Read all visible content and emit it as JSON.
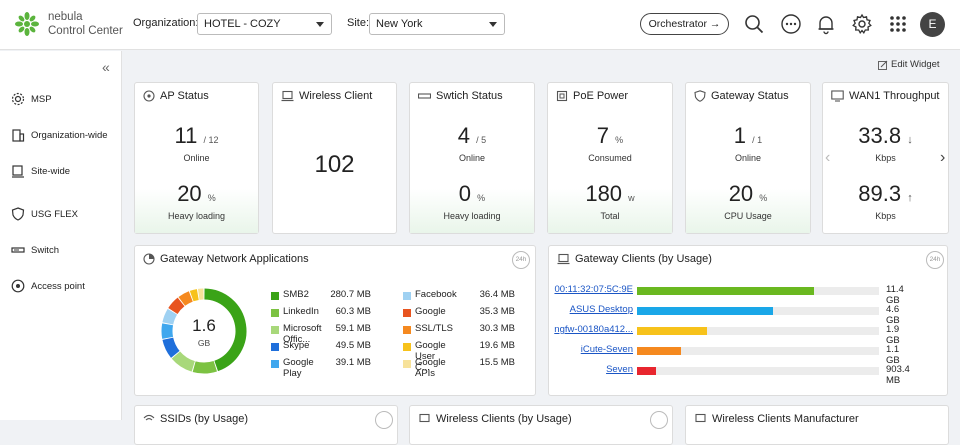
{
  "app": {
    "brand_line1": "nebula",
    "brand_line2": "Control Center"
  },
  "header": {
    "org_label": "Organization:",
    "org_value": "HOTEL - COZY",
    "site_label": "Site:",
    "site_value": "New York",
    "orchestrator_label": "Orchestrator →",
    "avatar_letter": "E",
    "icons": [
      "search-icon",
      "more-icon",
      "bell-icon",
      "gear-icon",
      "apps-grid-icon"
    ]
  },
  "sidebar": {
    "collapse": "«",
    "items": [
      {
        "label": "MSP",
        "icon": "msp-icon"
      },
      {
        "label": "Organization-wide",
        "icon": "building-icon"
      },
      {
        "label": "Site-wide",
        "icon": "site-icon"
      },
      {
        "label": "USG FLEX",
        "icon": "shield-icon"
      },
      {
        "label": "Switch",
        "icon": "switch-icon"
      },
      {
        "label": "Access point",
        "icon": "access-point-icon"
      }
    ]
  },
  "edit_widget": "Edit Widget",
  "cards": {
    "ap": {
      "title": "AP Status",
      "top_value": "11",
      "top_unit": "/ 12",
      "top_label": "Online",
      "bottom_value": "20",
      "bottom_unit": "%",
      "bottom_label": "Heavy loading"
    },
    "wireless": {
      "title": "Wireless Client",
      "value": "102"
    },
    "switch": {
      "title": "Swtich Status",
      "top_value": "4",
      "top_unit": "/ 5",
      "top_label": "Online",
      "bottom_value": "0",
      "bottom_unit": "%",
      "bottom_label": "Heavy loading"
    },
    "poe": {
      "title": "PoE Power",
      "top_value": "7",
      "top_unit": "%",
      "top_label": "Consumed",
      "bottom_value": "180",
      "bottom_unit": "w",
      "bottom_label": "Total"
    },
    "gateway": {
      "title": "Gateway Status",
      "top_value": "1",
      "top_unit": "/ 1",
      "top_label": "Online",
      "bottom_value": "20",
      "bottom_unit": "%",
      "bottom_label": "CPU Usage"
    },
    "wan": {
      "title": "WAN1 Throughput",
      "top_value": "33.8",
      "top_arrow": "↓",
      "top_label": "Kbps",
      "bottom_value": "89.3",
      "bottom_arrow": "↑",
      "bottom_label": "Kbps",
      "prev": "‹",
      "next": "›"
    }
  },
  "apps": {
    "title": "Gateway Network Applications",
    "badge": "24h",
    "total_value": "1.6",
    "total_unit": "GB",
    "left": [
      {
        "name": "SMB2",
        "value": "280.7 MB",
        "color": "#3aa317"
      },
      {
        "name": "LinkedIn",
        "value": "60.3 MB",
        "color": "#7cc242"
      },
      {
        "name": "Microsoft Offic...",
        "value": "59.1 MB",
        "color": "#a8d87a"
      },
      {
        "name": "Skype",
        "value": "49.5 MB",
        "color": "#1f6fdb"
      },
      {
        "name": "Google Play",
        "value": "39.1 MB",
        "color": "#3fa7ee"
      }
    ],
    "right": [
      {
        "name": "Facebook",
        "value": "36.4 MB",
        "color": "#9fd1f2"
      },
      {
        "name": "Google",
        "value": "35.3 MB",
        "color": "#e8541f"
      },
      {
        "name": "SSL/TLS",
        "value": "30.3 MB",
        "color": "#f5891f"
      },
      {
        "name": "Google User C...",
        "value": "19.6 MB",
        "color": "#f7c21b"
      },
      {
        "name": "Google APIs",
        "value": "15.5 MB",
        "color": "#f7e29a"
      }
    ]
  },
  "clients": {
    "title": "Gateway Clients (by Usage)",
    "badge": "24h",
    "rows": [
      {
        "name": "00:11:32:07:5C:9E",
        "value": "11.4 GB",
        "fraction": 0.73,
        "color": "#6ab820"
      },
      {
        "name": "ASUS Desktop",
        "value": "4.6 GB",
        "fraction": 0.56,
        "color": "#1aa7e8"
      },
      {
        "name": "ngfw-00180a412...",
        "value": "1.9 GB",
        "fraction": 0.29,
        "color": "#f7c21b"
      },
      {
        "name": "iCute-Seven",
        "value": "1.1 GB",
        "fraction": 0.18,
        "color": "#f5891f"
      },
      {
        "name": "Seven",
        "value": "903.4 MB",
        "fraction": 0.08,
        "color": "#e8262e"
      }
    ]
  },
  "bottom_cards": [
    {
      "title": "SSIDs (by Usage)"
    },
    {
      "title": "Wireless Clients (by Usage)"
    },
    {
      "title": "Wireless Clients Manufacturer"
    }
  ]
}
